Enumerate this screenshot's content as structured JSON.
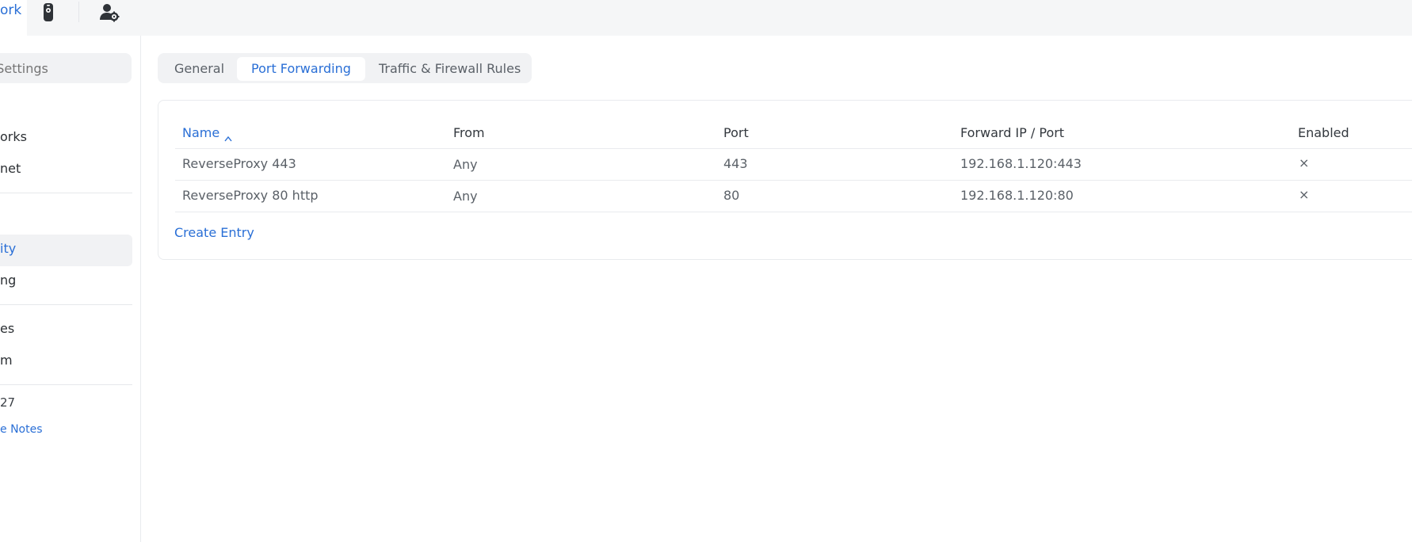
{
  "topbar": {
    "active_tab_label": "ork",
    "icons": [
      "device-icon",
      "user-settings-icon"
    ]
  },
  "sidebar": {
    "search_placeholder": "n Settings",
    "items": [
      {
        "label": "orks"
      },
      {
        "label": "net"
      },
      {
        "label": "ity",
        "active": true
      },
      {
        "label": "ng"
      },
      {
        "label": "es"
      },
      {
        "label": "m"
      },
      {
        "label": "27"
      },
      {
        "label": "e Notes",
        "link": true
      }
    ]
  },
  "main": {
    "tabs": [
      {
        "label": "General",
        "active": false
      },
      {
        "label": "Port Forwarding",
        "active": true
      },
      {
        "label": "Traffic & Firewall Rules",
        "active": false
      }
    ],
    "table": {
      "columns": [
        "Name",
        "From",
        "Port",
        "Forward IP / Port",
        "Enabled"
      ],
      "sorted_column": "Name",
      "sort_direction": "ascending",
      "rows": [
        {
          "name": "ReverseProxy 443",
          "from": "Any",
          "port": "443",
          "forward": "192.168.1.120:443",
          "enabled": "×"
        },
        {
          "name": "ReverseProxy 80 http",
          "from": "Any",
          "port": "80",
          "forward": "192.168.1.120:80",
          "enabled": "×"
        }
      ]
    },
    "create_entry_label": "Create Entry"
  },
  "colors": {
    "accent": "#2a6fd6",
    "text": "#50565e",
    "surface": "#f1f2f4"
  }
}
